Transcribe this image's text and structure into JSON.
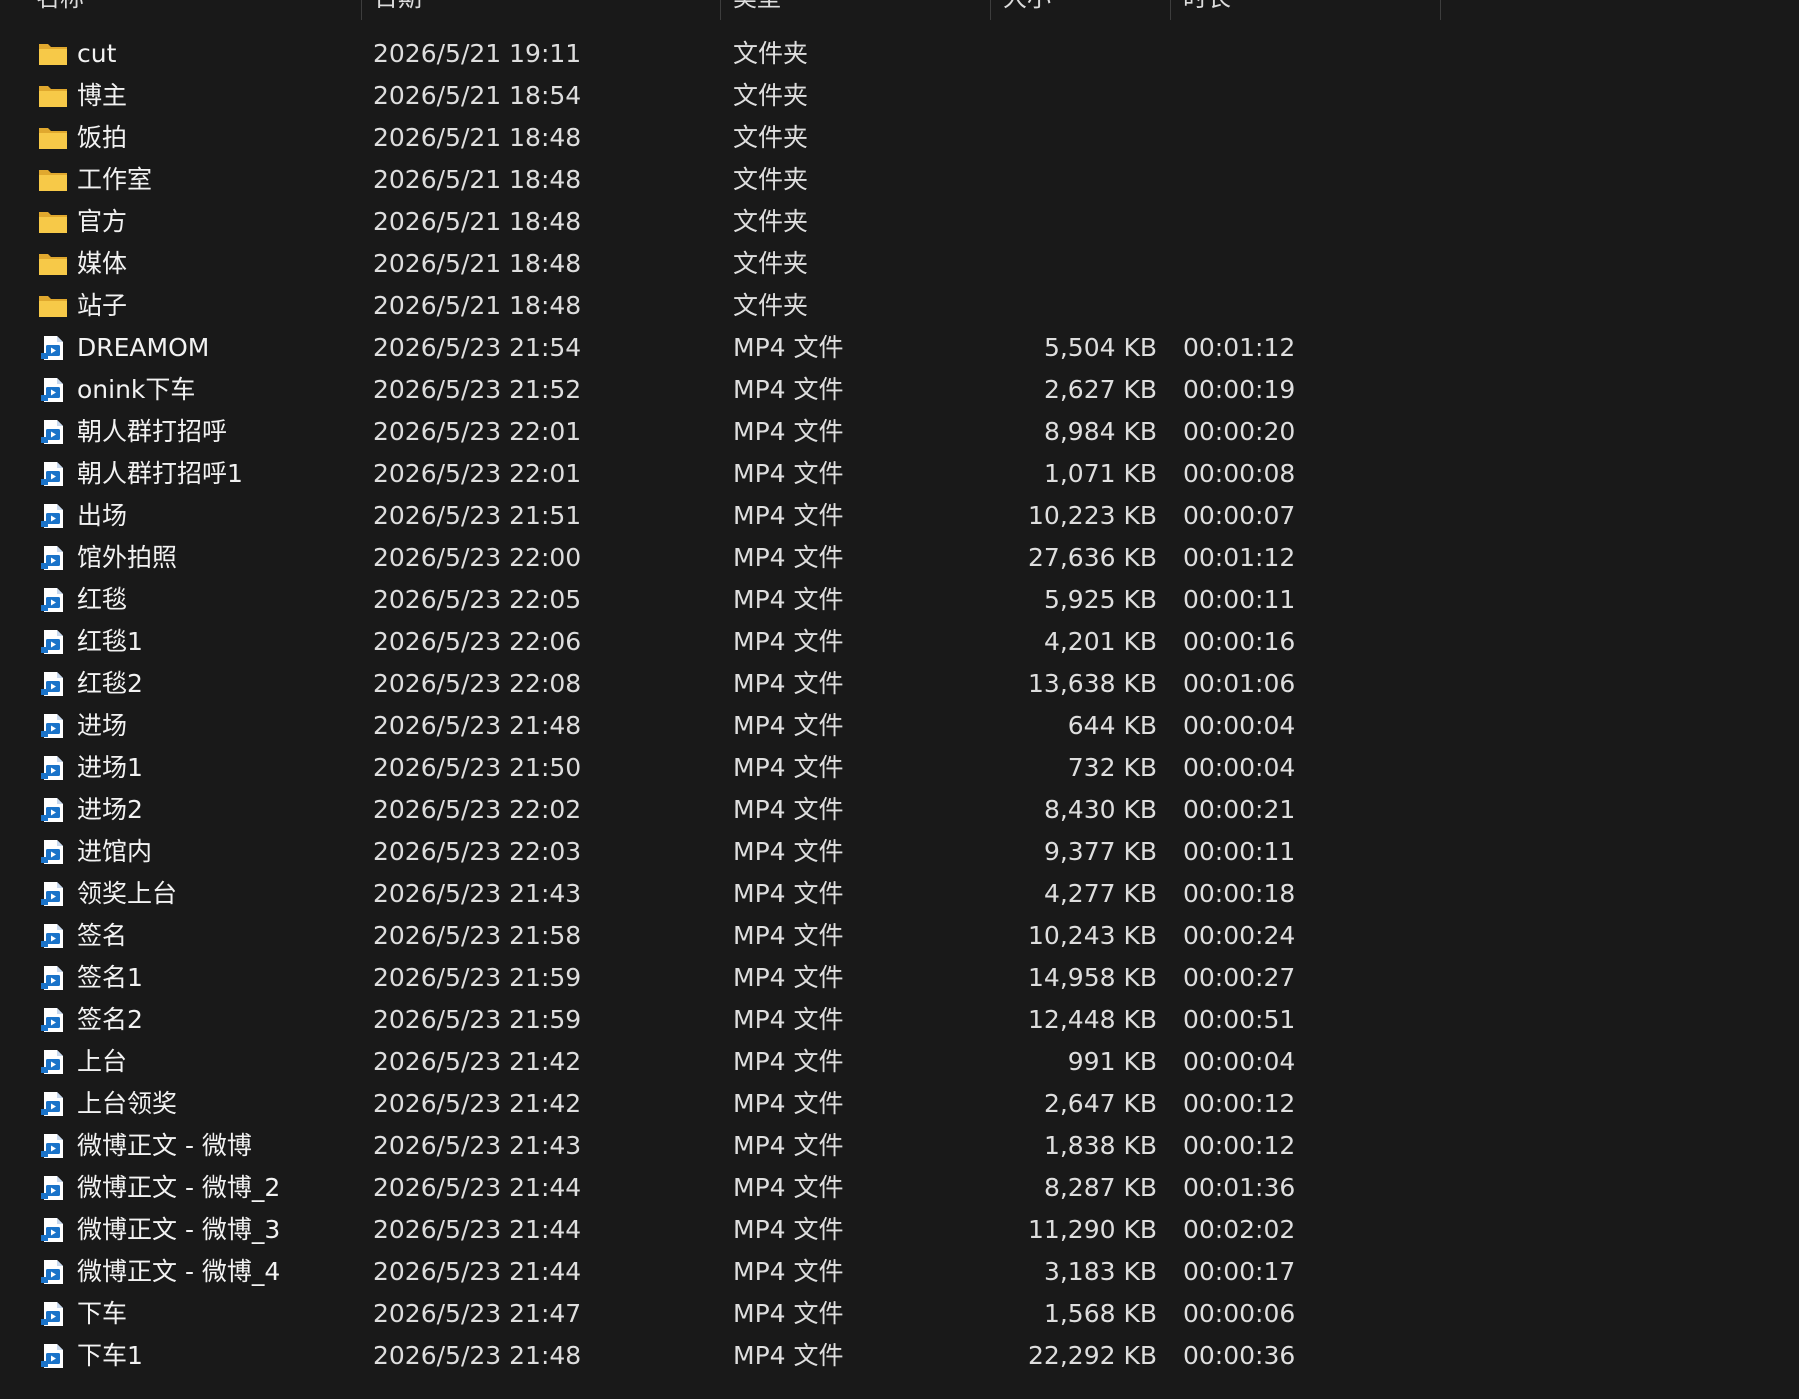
{
  "columns": [
    {
      "key": "name",
      "label": "名称"
    },
    {
      "key": "date",
      "label": "日期"
    },
    {
      "key": "type",
      "label": "类型"
    },
    {
      "key": "size",
      "label": "大小"
    },
    {
      "key": "duration",
      "label": "时长"
    }
  ],
  "icons": {
    "folder": "folder-icon",
    "video": "mp4-file-icon"
  },
  "colors": {
    "background": "#191919",
    "folder": "#f7c948",
    "video_accent": "#1a73c9"
  },
  "files": [
    {
      "icon": "folder",
      "name": "cut",
      "date": "2026/5/21 19:11",
      "type": "文件夹",
      "size": "",
      "duration": ""
    },
    {
      "icon": "folder",
      "name": "博主",
      "date": "2026/5/21 18:54",
      "type": "文件夹",
      "size": "",
      "duration": ""
    },
    {
      "icon": "folder",
      "name": "饭拍",
      "date": "2026/5/21 18:48",
      "type": "文件夹",
      "size": "",
      "duration": ""
    },
    {
      "icon": "folder",
      "name": "工作室",
      "date": "2026/5/21 18:48",
      "type": "文件夹",
      "size": "",
      "duration": ""
    },
    {
      "icon": "folder",
      "name": "官方",
      "date": "2026/5/21 18:48",
      "type": "文件夹",
      "size": "",
      "duration": ""
    },
    {
      "icon": "folder",
      "name": "媒体",
      "date": "2026/5/21 18:48",
      "type": "文件夹",
      "size": "",
      "duration": ""
    },
    {
      "icon": "folder",
      "name": "站子",
      "date": "2026/5/21 18:48",
      "type": "文件夹",
      "size": "",
      "duration": ""
    },
    {
      "icon": "video",
      "name": "DREAMOM",
      "date": "2026/5/23 21:54",
      "type": "MP4 文件",
      "size": "5,504 KB",
      "duration": "00:01:12"
    },
    {
      "icon": "video",
      "name": "onink下车",
      "date": "2026/5/23 21:52",
      "type": "MP4 文件",
      "size": "2,627 KB",
      "duration": "00:00:19"
    },
    {
      "icon": "video",
      "name": "朝人群打招呼",
      "date": "2026/5/23 22:01",
      "type": "MP4 文件",
      "size": "8,984 KB",
      "duration": "00:00:20"
    },
    {
      "icon": "video",
      "name": "朝人群打招呼1",
      "date": "2026/5/23 22:01",
      "type": "MP4 文件",
      "size": "1,071 KB",
      "duration": "00:00:08"
    },
    {
      "icon": "video",
      "name": "出场",
      "date": "2026/5/23 21:51",
      "type": "MP4 文件",
      "size": "10,223 KB",
      "duration": "00:00:07"
    },
    {
      "icon": "video",
      "name": "馆外拍照",
      "date": "2026/5/23 22:00",
      "type": "MP4 文件",
      "size": "27,636 KB",
      "duration": "00:01:12"
    },
    {
      "icon": "video",
      "name": "红毯",
      "date": "2026/5/23 22:05",
      "type": "MP4 文件",
      "size": "5,925 KB",
      "duration": "00:00:11"
    },
    {
      "icon": "video",
      "name": "红毯1",
      "date": "2026/5/23 22:06",
      "type": "MP4 文件",
      "size": "4,201 KB",
      "duration": "00:00:16"
    },
    {
      "icon": "video",
      "name": "红毯2",
      "date": "2026/5/23 22:08",
      "type": "MP4 文件",
      "size": "13,638 KB",
      "duration": "00:01:06"
    },
    {
      "icon": "video",
      "name": "进场",
      "date": "2026/5/23 21:48",
      "type": "MP4 文件",
      "size": "644 KB",
      "duration": "00:00:04"
    },
    {
      "icon": "video",
      "name": "进场1",
      "date": "2026/5/23 21:50",
      "type": "MP4 文件",
      "size": "732 KB",
      "duration": "00:00:04"
    },
    {
      "icon": "video",
      "name": "进场2",
      "date": "2026/5/23 22:02",
      "type": "MP4 文件",
      "size": "8,430 KB",
      "duration": "00:00:21"
    },
    {
      "icon": "video",
      "name": "进馆内",
      "date": "2026/5/23 22:03",
      "type": "MP4 文件",
      "size": "9,377 KB",
      "duration": "00:00:11"
    },
    {
      "icon": "video",
      "name": "领奖上台",
      "date": "2026/5/23 21:43",
      "type": "MP4 文件",
      "size": "4,277 KB",
      "duration": "00:00:18"
    },
    {
      "icon": "video",
      "name": "签名",
      "date": "2026/5/23 21:58",
      "type": "MP4 文件",
      "size": "10,243 KB",
      "duration": "00:00:24"
    },
    {
      "icon": "video",
      "name": "签名1",
      "date": "2026/5/23 21:59",
      "type": "MP4 文件",
      "size": "14,958 KB",
      "duration": "00:00:27"
    },
    {
      "icon": "video",
      "name": "签名2",
      "date": "2026/5/23 21:59",
      "type": "MP4 文件",
      "size": "12,448 KB",
      "duration": "00:00:51"
    },
    {
      "icon": "video",
      "name": "上台",
      "date": "2026/5/23 21:42",
      "type": "MP4 文件",
      "size": "991 KB",
      "duration": "00:00:04"
    },
    {
      "icon": "video",
      "name": "上台领奖",
      "date": "2026/5/23 21:42",
      "type": "MP4 文件",
      "size": "2,647 KB",
      "duration": "00:00:12"
    },
    {
      "icon": "video",
      "name": "微博正文 - 微博",
      "date": "2026/5/23 21:43",
      "type": "MP4 文件",
      "size": "1,838 KB",
      "duration": "00:00:12"
    },
    {
      "icon": "video",
      "name": "微博正文 - 微博_2",
      "date": "2026/5/23 21:44",
      "type": "MP4 文件",
      "size": "8,287 KB",
      "duration": "00:01:36"
    },
    {
      "icon": "video",
      "name": "微博正文 - 微博_3",
      "date": "2026/5/23 21:44",
      "type": "MP4 文件",
      "size": "11,290 KB",
      "duration": "00:02:02"
    },
    {
      "icon": "video",
      "name": "微博正文 - 微博_4",
      "date": "2026/5/23 21:44",
      "type": "MP4 文件",
      "size": "3,183 KB",
      "duration": "00:00:17"
    },
    {
      "icon": "video",
      "name": "下车",
      "date": "2026/5/23 21:47",
      "type": "MP4 文件",
      "size": "1,568 KB",
      "duration": "00:00:06"
    },
    {
      "icon": "video",
      "name": "下车1",
      "date": "2026/5/23 21:48",
      "type": "MP4 文件",
      "size": "22,292 KB",
      "duration": "00:00:36"
    }
  ]
}
